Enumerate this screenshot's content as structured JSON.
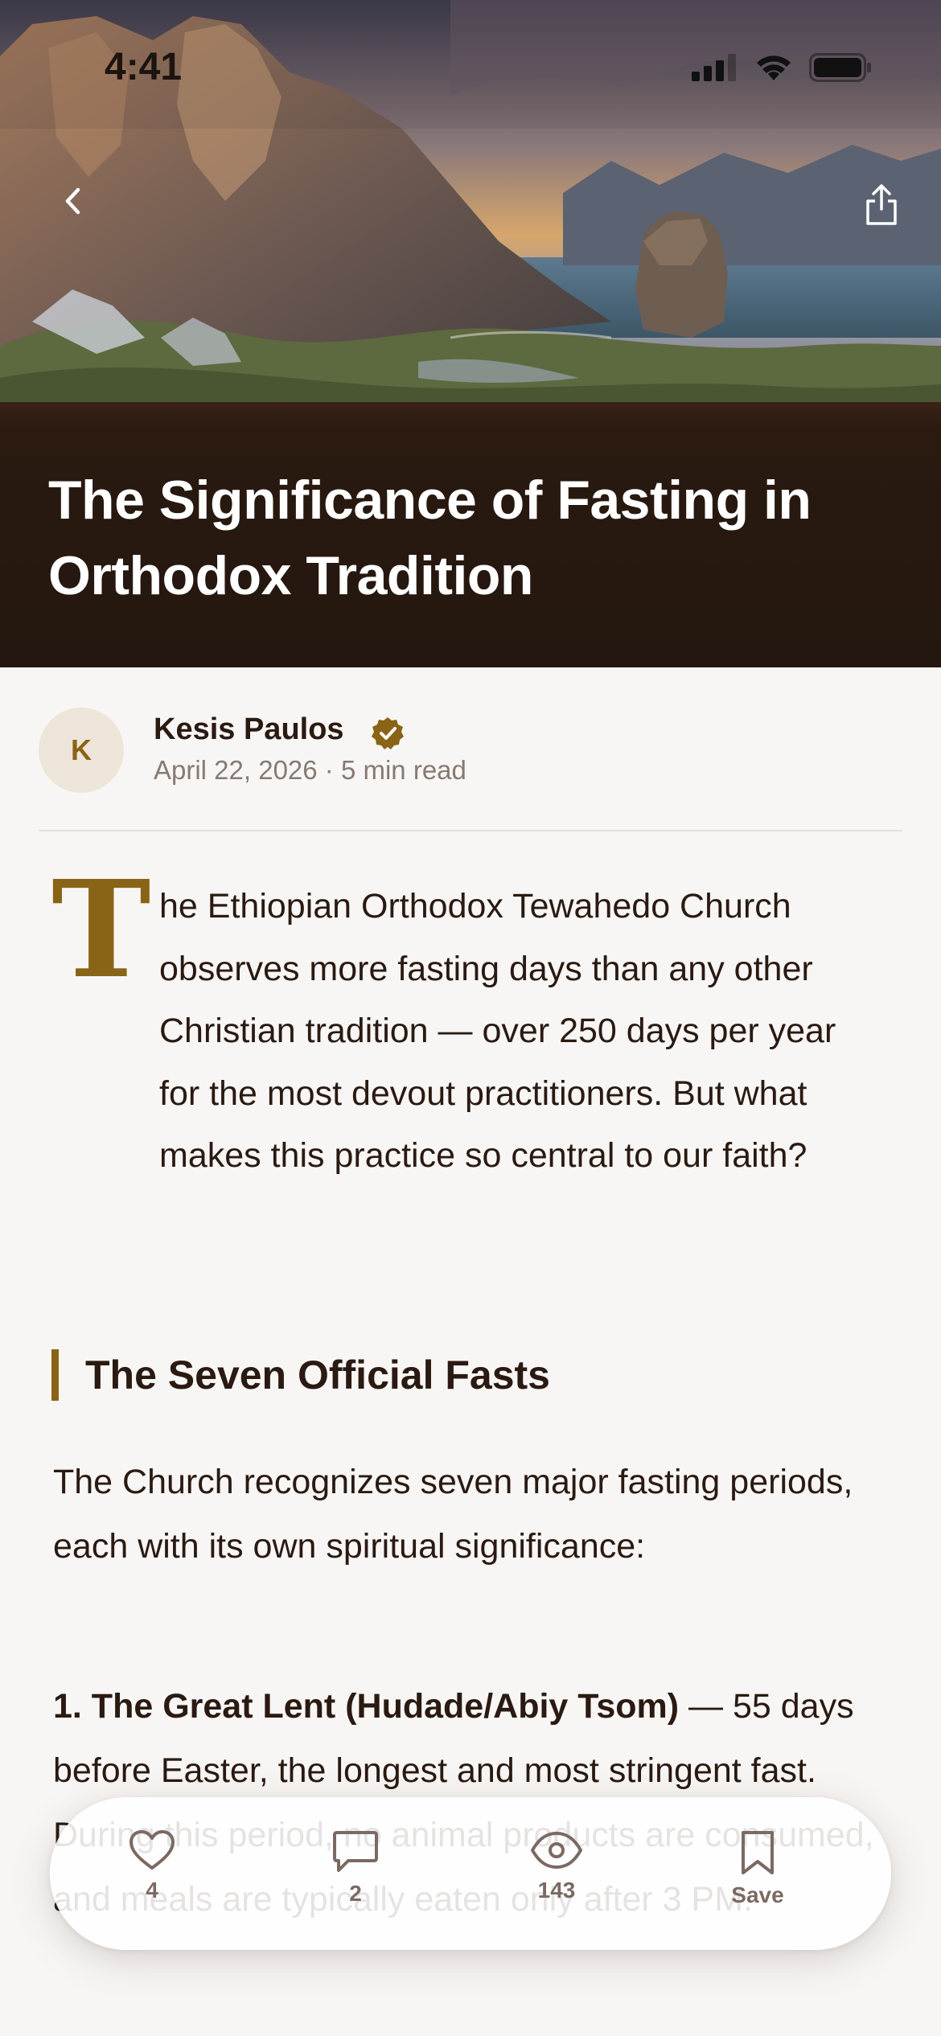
{
  "status_bar": {
    "time": "4:41"
  },
  "article": {
    "title": "The Significance of Fasting in Orthodox Tradition",
    "author": {
      "name": "Kesis Paulos",
      "initial": "K",
      "verified": true
    },
    "meta": "April 22, 2026 · 5 min read",
    "dropcap": "T",
    "intro": "he Ethiopian Orthodox Tewahedo Church observes more fasting days than any other Christian tradition — over 250 days per year for the most devout practitioners. But what makes this practice so central to our faith?",
    "section_heading": "The Seven Official Fasts",
    "paragraph": "The Church recognizes seven major fasting periods, each with its own spiritual significance:",
    "list_item_1": {
      "bold": "1. The Great Lent (Hudade/Abiy Tsom)",
      "text": " — 55 days before Easter, the longest and most stringent fast. During this period, no animal products are consumed, and meals are typically eaten only after 3 PM."
    }
  },
  "actions": {
    "likes": "4",
    "comments": "2",
    "views": "143",
    "save": "Save"
  },
  "colors": {
    "accent": "#8a6416",
    "title_band": "#24170f",
    "background": "#f8f6f4",
    "text": "#2a1a12"
  },
  "icons": [
    "back-chevron-icon",
    "share-icon",
    "verified-badge-icon",
    "heart-icon",
    "comment-icon",
    "eye-icon",
    "bookmark-icon",
    "signal-icon",
    "wifi-icon",
    "battery-icon"
  ]
}
